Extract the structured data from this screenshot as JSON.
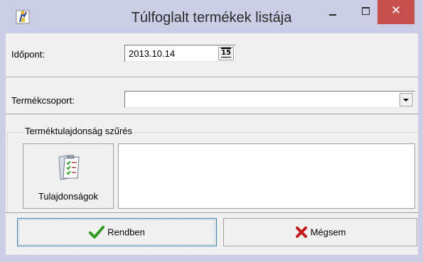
{
  "window": {
    "title": "Túlfoglalt termékek listája",
    "controls": {
      "minimize": "minimize",
      "maximize": "maximize",
      "close": "✕"
    }
  },
  "form": {
    "date_label": "Időpont:",
    "date_value": "2013.10.14",
    "date_picker_text": "15",
    "group_label": "Termékcsoport:",
    "group_value": ""
  },
  "filter": {
    "legend": "Terméktulajdonság szűrés",
    "properties_button": "Tulajdonságok",
    "properties_list": []
  },
  "actions": {
    "ok_label": "Rendben",
    "cancel_label": "Mégsem"
  },
  "colors": {
    "titlebar": "#c9cde6",
    "close_button": "#c7504f",
    "panel": "#f0f0f0",
    "ok_icon": "#2f9a1f",
    "cancel_icon": "#c0181c"
  }
}
